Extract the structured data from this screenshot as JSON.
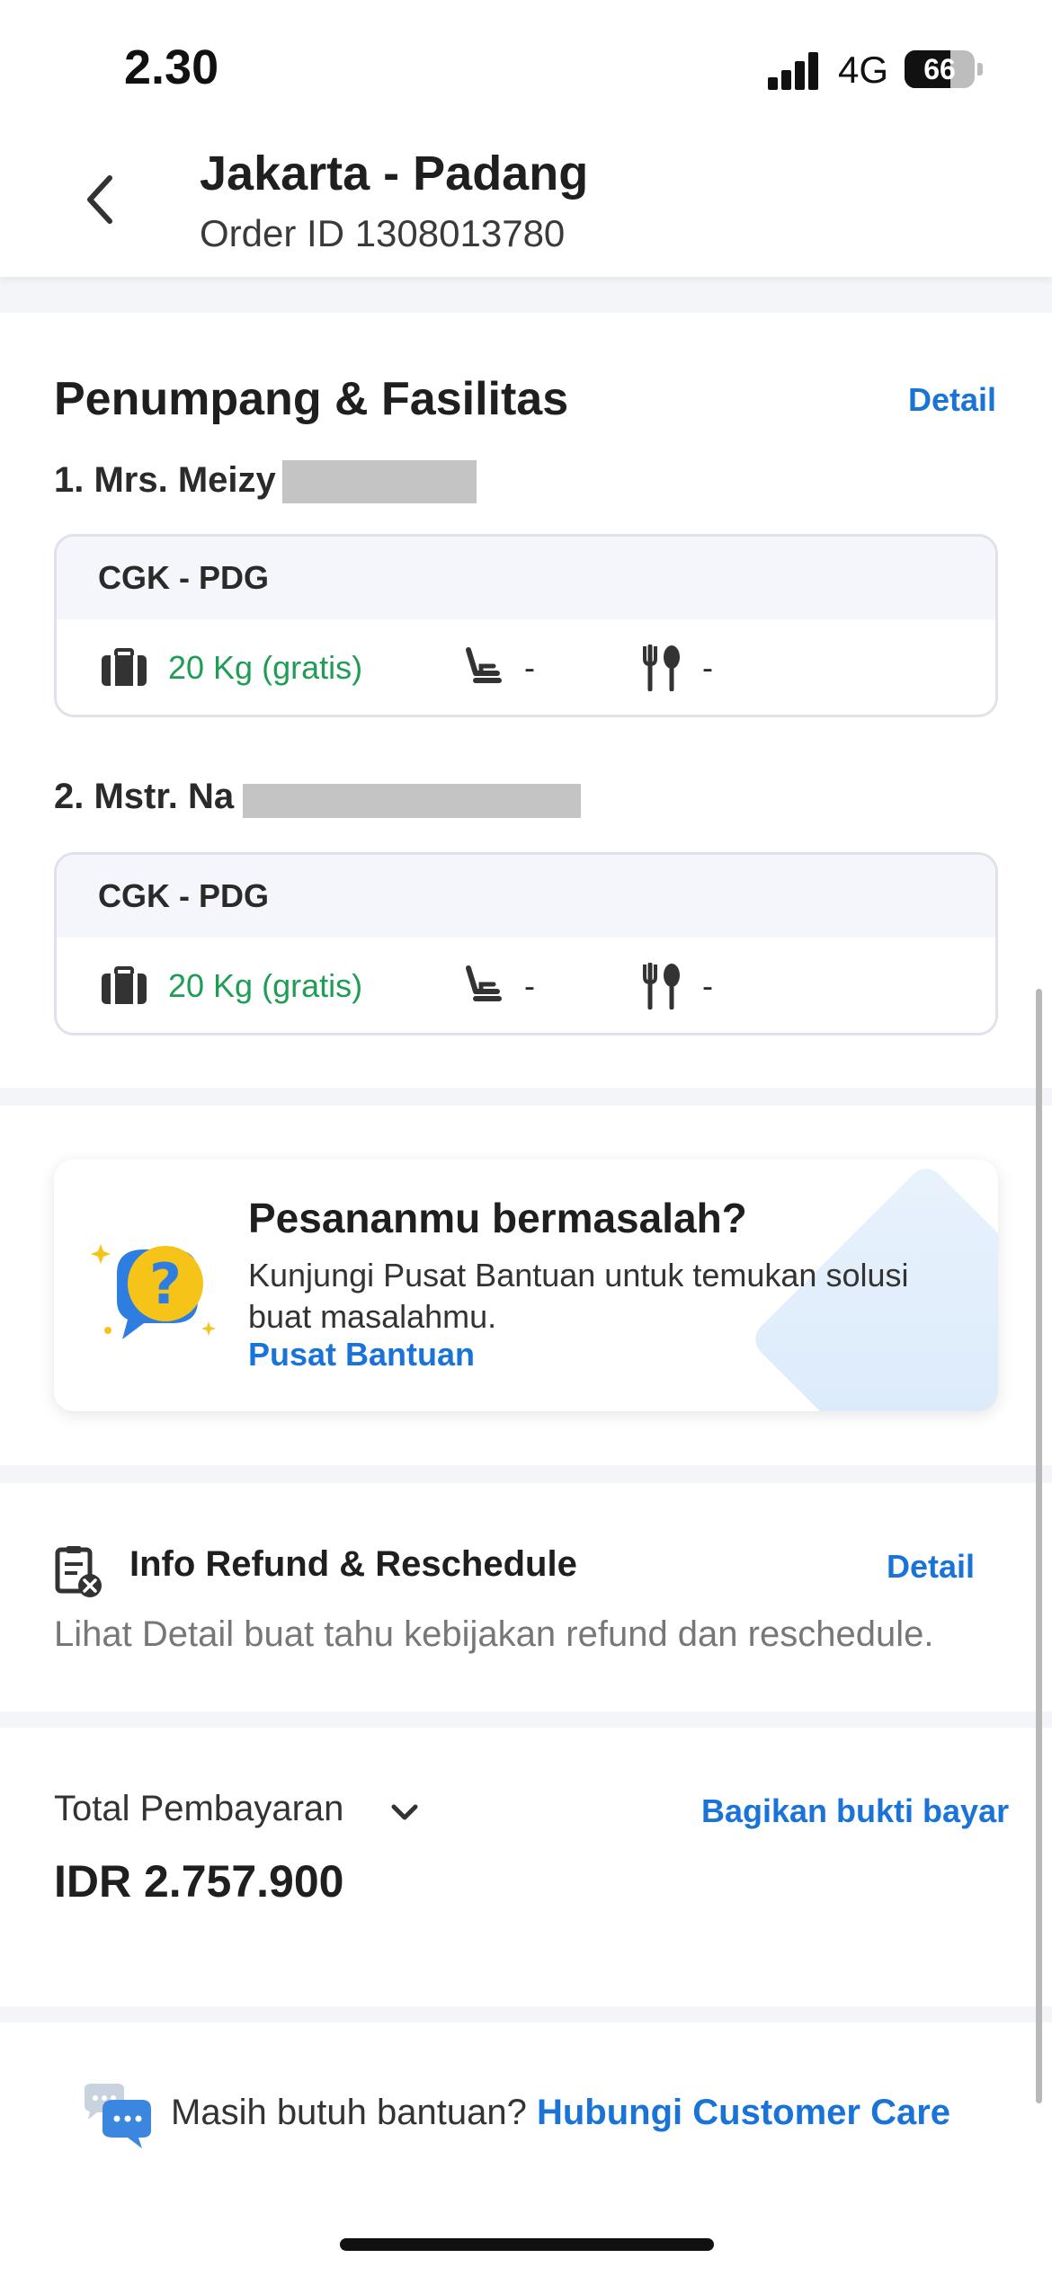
{
  "status_bar": {
    "time": "2.30",
    "network": "4G",
    "battery": "66",
    "battery_level": 0.66
  },
  "header": {
    "title": "Jakarta - Padang",
    "order_id": "Order ID 1308013780"
  },
  "passengers_section": {
    "title": "Penumpang & Fasilitas",
    "detail_label": "Detail",
    "passengers": [
      {
        "name": "1. Mrs. Meizy",
        "route": "CGK - PDG",
        "baggage": "20 Kg (gratis)",
        "seat": "-",
        "meal": "-"
      },
      {
        "name": "2. Mstr. Na",
        "route": "CGK - PDG",
        "baggage": "20 Kg (gratis)",
        "seat": "-",
        "meal": "-"
      }
    ]
  },
  "help_card": {
    "title": "Pesananmu bermasalah?",
    "description": "Kunjungi Pusat Bantuan untuk temukan solusi buat masalahmu.",
    "link_label": "Pusat Bantuan"
  },
  "refund": {
    "title": "Info Refund & Reschedule",
    "detail_label": "Detail",
    "description": "Lihat Detail buat tahu kebijakan refund dan reschedule."
  },
  "payment": {
    "label": "Total Pembayaran",
    "share_label": "Bagikan bukti bayar",
    "amount": "IDR 2.757.900"
  },
  "footer": {
    "question": "Masih butuh bantuan?",
    "link_label": "Hubungi Customer Care"
  },
  "colors": {
    "accent": "#1a73d6",
    "baggage_green": "#1f9d55"
  }
}
